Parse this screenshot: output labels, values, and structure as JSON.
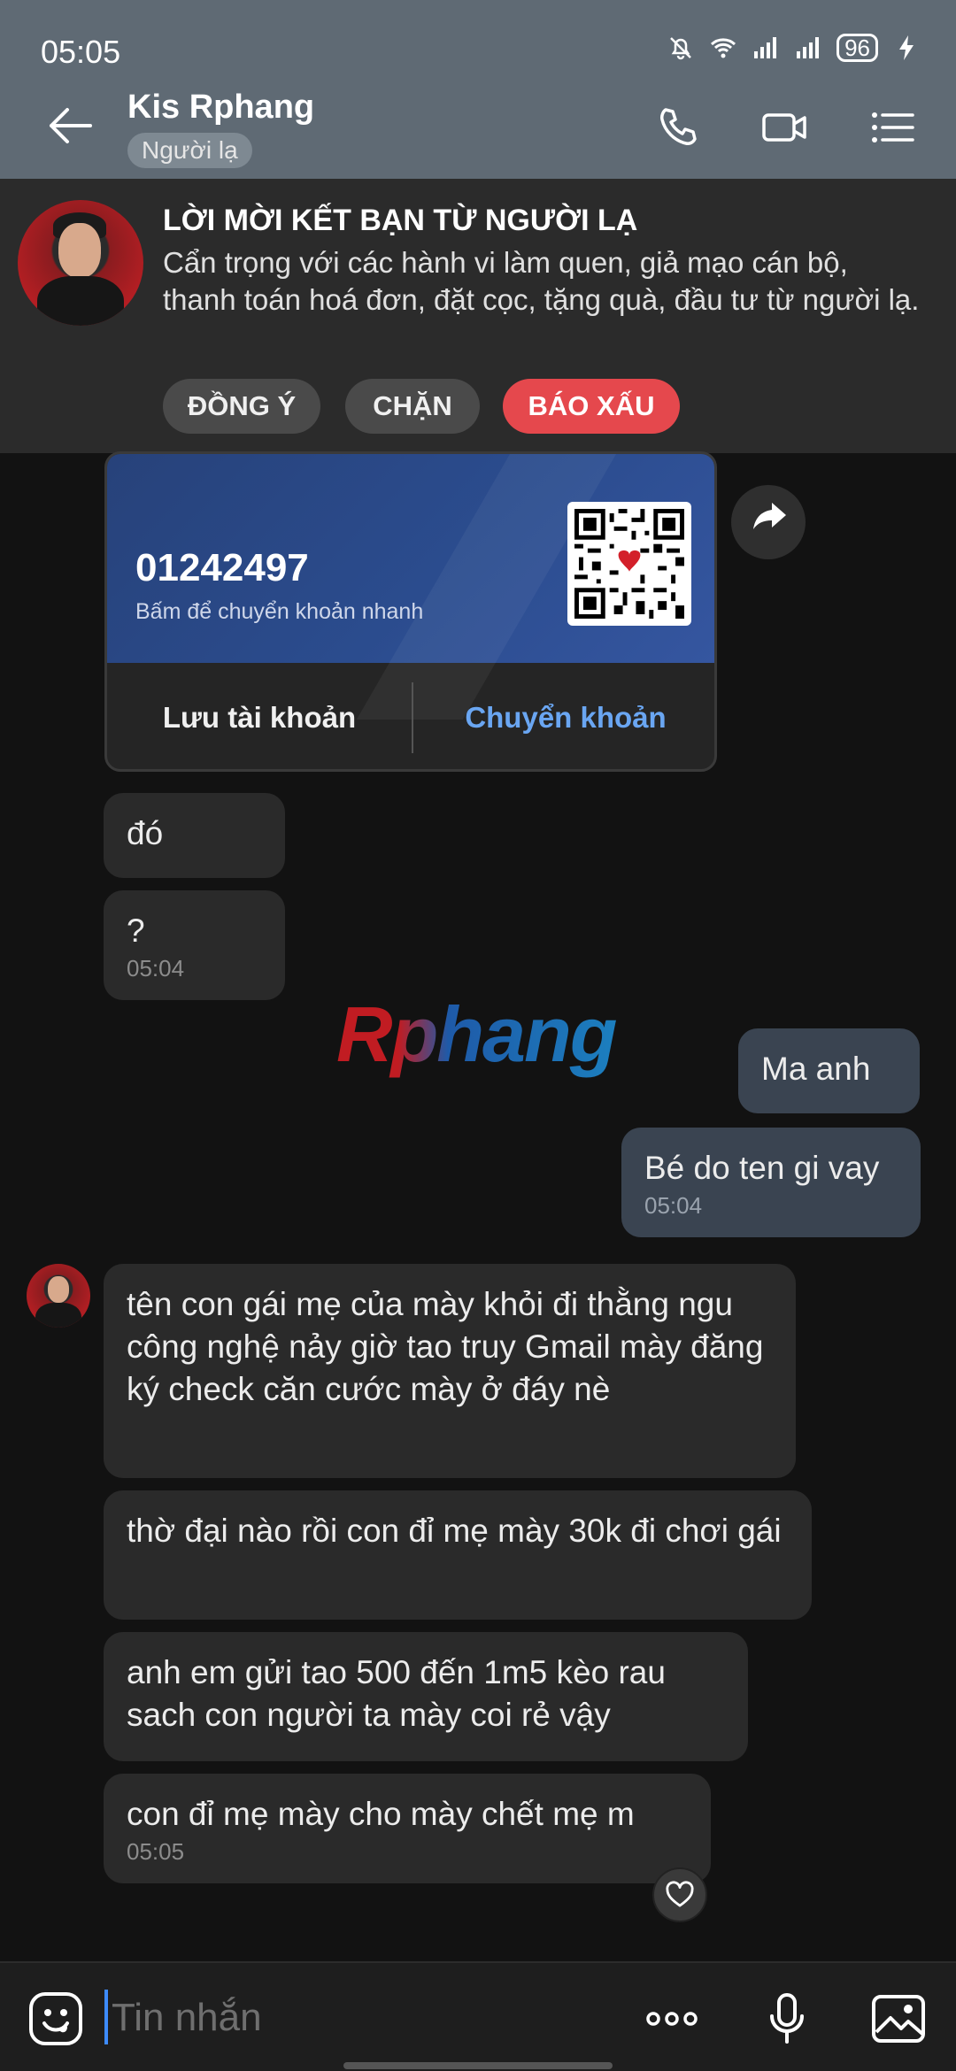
{
  "status_bar": {
    "time": "05:05",
    "battery": "96"
  },
  "header": {
    "title": "Kis Rphang",
    "badge": "Người lạ"
  },
  "banner": {
    "title": "LỜI MỜI KẾT BẠN TỪ NGƯỜI LẠ",
    "text": "Cẩn trọng với các hành vi làm quen, giả mạo cán bộ, thanh toán hoá đơn, đặt cọc, tặng quà, đầu tư từ người lạ.",
    "accept": "ĐỒNG Ý",
    "block": "CHẶN",
    "report": "BÁO XẤU"
  },
  "bank_card": {
    "account_number": "01242497",
    "hint": "Bấm để chuyển khoản nhanh",
    "save_label": "Lưu tài khoản",
    "transfer_label": "Chuyển khoản"
  },
  "messages": [
    {
      "text": "đó"
    },
    {
      "text": "?",
      "time": "05:04"
    },
    {
      "text": "Ma anh"
    },
    {
      "text": "Bé do ten gi vay",
      "time": "05:04"
    },
    {
      "text": "tên con gái mẹ của mày khỏi đi thằng ngu công nghệ nảy giờ tao truy Gmail mày đăng ký check căn cước mày ở đáy nè"
    },
    {
      "text": "thờ đại nào rồi con đỉ mẹ mày 30k đi chơi gái"
    },
    {
      "text": "anh em gửi tao 500 đến 1m5 kèo rau sach con người ta mày coi rẻ vậy"
    },
    {
      "text": "con đỉ mẹ mày cho mày chết mẹ m",
      "time": "05:05"
    }
  ],
  "watermark": "Rphang",
  "composer": {
    "placeholder": "Tin nhắn"
  },
  "colors": {
    "header_bg": "#5f6a74",
    "report_red": "#e5484d",
    "link_blue": "#6aa6f2",
    "outgoing_bubble": "#3a4451"
  }
}
